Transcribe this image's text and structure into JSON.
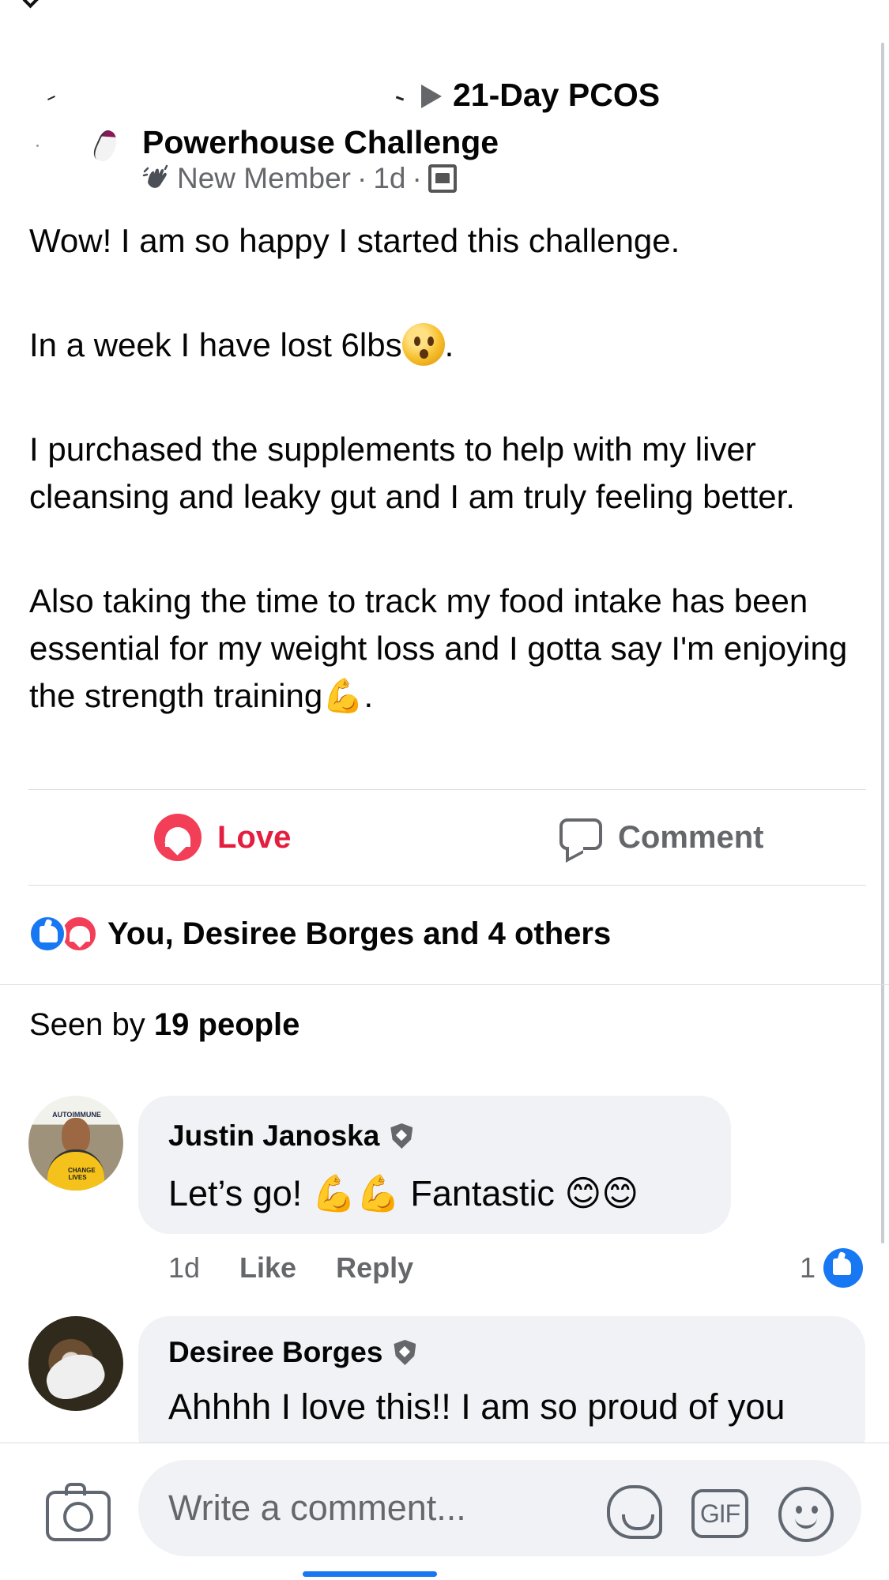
{
  "post": {
    "group_title_line_1": "21-Day PCOS",
    "group_title_line_2": "Powerhouse Challenge",
    "badge": "New Member",
    "timestamp": "1d",
    "privacy_icon": "group-members-icon",
    "body": [
      "Wow! I am so happy I started this challenge.",
      "In a week I have lost 6lbs",
      "I purchased the supplements to help with my liver cleansing and leaky gut and I am truly feeling better.",
      "Also taking the time to track my food intake has been essential for my weight loss and I gotta say I'm enjoying the strength training"
    ],
    "body_emoji": {
      "shocked": "😲",
      "strength": "💪"
    }
  },
  "actions": {
    "love_label": "Love",
    "comment_label": "Comment"
  },
  "reactions": {
    "summary": "You, Desiree Borges and 4 others",
    "icons": [
      "like-reaction-icon",
      "love-reaction-icon"
    ]
  },
  "seen": {
    "prefix": "Seen by",
    "count": "19 people"
  },
  "comments": [
    {
      "author": "Justin Janoska",
      "avatar_text": "AUTOIMMUNE",
      "avatar_badge": "CHANGE LIVES",
      "text": "Let’s go! 💪💪 Fantastic 😊😊",
      "time": "1d",
      "like_action": "Like",
      "reply_action": "Reply",
      "like_count": "1"
    },
    {
      "author": "Desiree Borges",
      "text": "Ahhhh I love this!! I am so proud of you"
    }
  ],
  "composer": {
    "placeholder": "Write a comment...",
    "gif_label": "GIF",
    "icons": [
      "camera-icon",
      "sticker-icon",
      "gif-icon",
      "emoji-icon"
    ]
  },
  "colors": {
    "accent_blue": "#1877f2",
    "love_red": "#e41e3f",
    "muted_text": "#65676b",
    "bubble_background": "#f0f2f5"
  }
}
